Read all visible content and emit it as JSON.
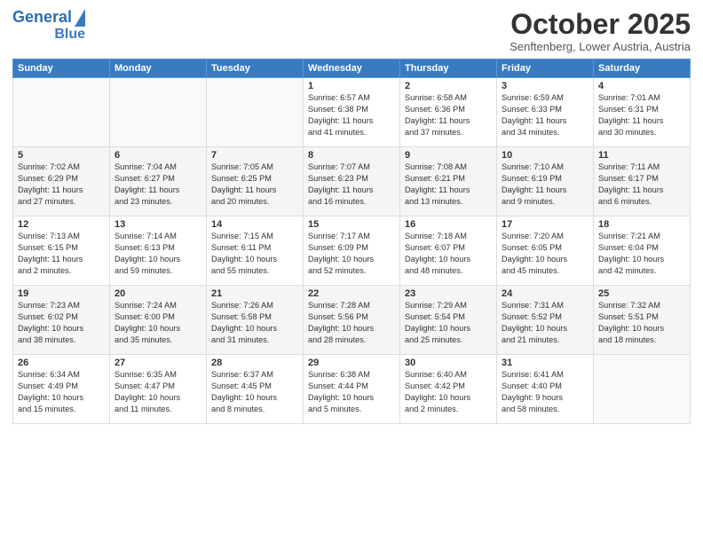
{
  "logo": {
    "line1": "General",
    "line2": "Blue"
  },
  "title": "October 2025",
  "subtitle": "Senftenberg, Lower Austria, Austria",
  "days_of_week": [
    "Sunday",
    "Monday",
    "Tuesday",
    "Wednesday",
    "Thursday",
    "Friday",
    "Saturday"
  ],
  "weeks": [
    [
      {
        "num": "",
        "content": ""
      },
      {
        "num": "",
        "content": ""
      },
      {
        "num": "",
        "content": ""
      },
      {
        "num": "1",
        "content": "Sunrise: 6:57 AM\nSunset: 6:38 PM\nDaylight: 11 hours\nand 41 minutes."
      },
      {
        "num": "2",
        "content": "Sunrise: 6:58 AM\nSunset: 6:36 PM\nDaylight: 11 hours\nand 37 minutes."
      },
      {
        "num": "3",
        "content": "Sunrise: 6:59 AM\nSunset: 6:33 PM\nDaylight: 11 hours\nand 34 minutes."
      },
      {
        "num": "4",
        "content": "Sunrise: 7:01 AM\nSunset: 6:31 PM\nDaylight: 11 hours\nand 30 minutes."
      }
    ],
    [
      {
        "num": "5",
        "content": "Sunrise: 7:02 AM\nSunset: 6:29 PM\nDaylight: 11 hours\nand 27 minutes."
      },
      {
        "num": "6",
        "content": "Sunrise: 7:04 AM\nSunset: 6:27 PM\nDaylight: 11 hours\nand 23 minutes."
      },
      {
        "num": "7",
        "content": "Sunrise: 7:05 AM\nSunset: 6:25 PM\nDaylight: 11 hours\nand 20 minutes."
      },
      {
        "num": "8",
        "content": "Sunrise: 7:07 AM\nSunset: 6:23 PM\nDaylight: 11 hours\nand 16 minutes."
      },
      {
        "num": "9",
        "content": "Sunrise: 7:08 AM\nSunset: 6:21 PM\nDaylight: 11 hours\nand 13 minutes."
      },
      {
        "num": "10",
        "content": "Sunrise: 7:10 AM\nSunset: 6:19 PM\nDaylight: 11 hours\nand 9 minutes."
      },
      {
        "num": "11",
        "content": "Sunrise: 7:11 AM\nSunset: 6:17 PM\nDaylight: 11 hours\nand 6 minutes."
      }
    ],
    [
      {
        "num": "12",
        "content": "Sunrise: 7:13 AM\nSunset: 6:15 PM\nDaylight: 11 hours\nand 2 minutes."
      },
      {
        "num": "13",
        "content": "Sunrise: 7:14 AM\nSunset: 6:13 PM\nDaylight: 10 hours\nand 59 minutes."
      },
      {
        "num": "14",
        "content": "Sunrise: 7:15 AM\nSunset: 6:11 PM\nDaylight: 10 hours\nand 55 minutes."
      },
      {
        "num": "15",
        "content": "Sunrise: 7:17 AM\nSunset: 6:09 PM\nDaylight: 10 hours\nand 52 minutes."
      },
      {
        "num": "16",
        "content": "Sunrise: 7:18 AM\nSunset: 6:07 PM\nDaylight: 10 hours\nand 48 minutes."
      },
      {
        "num": "17",
        "content": "Sunrise: 7:20 AM\nSunset: 6:05 PM\nDaylight: 10 hours\nand 45 minutes."
      },
      {
        "num": "18",
        "content": "Sunrise: 7:21 AM\nSunset: 6:04 PM\nDaylight: 10 hours\nand 42 minutes."
      }
    ],
    [
      {
        "num": "19",
        "content": "Sunrise: 7:23 AM\nSunset: 6:02 PM\nDaylight: 10 hours\nand 38 minutes."
      },
      {
        "num": "20",
        "content": "Sunrise: 7:24 AM\nSunset: 6:00 PM\nDaylight: 10 hours\nand 35 minutes."
      },
      {
        "num": "21",
        "content": "Sunrise: 7:26 AM\nSunset: 5:58 PM\nDaylight: 10 hours\nand 31 minutes."
      },
      {
        "num": "22",
        "content": "Sunrise: 7:28 AM\nSunset: 5:56 PM\nDaylight: 10 hours\nand 28 minutes."
      },
      {
        "num": "23",
        "content": "Sunrise: 7:29 AM\nSunset: 5:54 PM\nDaylight: 10 hours\nand 25 minutes."
      },
      {
        "num": "24",
        "content": "Sunrise: 7:31 AM\nSunset: 5:52 PM\nDaylight: 10 hours\nand 21 minutes."
      },
      {
        "num": "25",
        "content": "Sunrise: 7:32 AM\nSunset: 5:51 PM\nDaylight: 10 hours\nand 18 minutes."
      }
    ],
    [
      {
        "num": "26",
        "content": "Sunrise: 6:34 AM\nSunset: 4:49 PM\nDaylight: 10 hours\nand 15 minutes."
      },
      {
        "num": "27",
        "content": "Sunrise: 6:35 AM\nSunset: 4:47 PM\nDaylight: 10 hours\nand 11 minutes."
      },
      {
        "num": "28",
        "content": "Sunrise: 6:37 AM\nSunset: 4:45 PM\nDaylight: 10 hours\nand 8 minutes."
      },
      {
        "num": "29",
        "content": "Sunrise: 6:38 AM\nSunset: 4:44 PM\nDaylight: 10 hours\nand 5 minutes."
      },
      {
        "num": "30",
        "content": "Sunrise: 6:40 AM\nSunset: 4:42 PM\nDaylight: 10 hours\nand 2 minutes."
      },
      {
        "num": "31",
        "content": "Sunrise: 6:41 AM\nSunset: 4:40 PM\nDaylight: 9 hours\nand 58 minutes."
      },
      {
        "num": "",
        "content": ""
      }
    ]
  ]
}
